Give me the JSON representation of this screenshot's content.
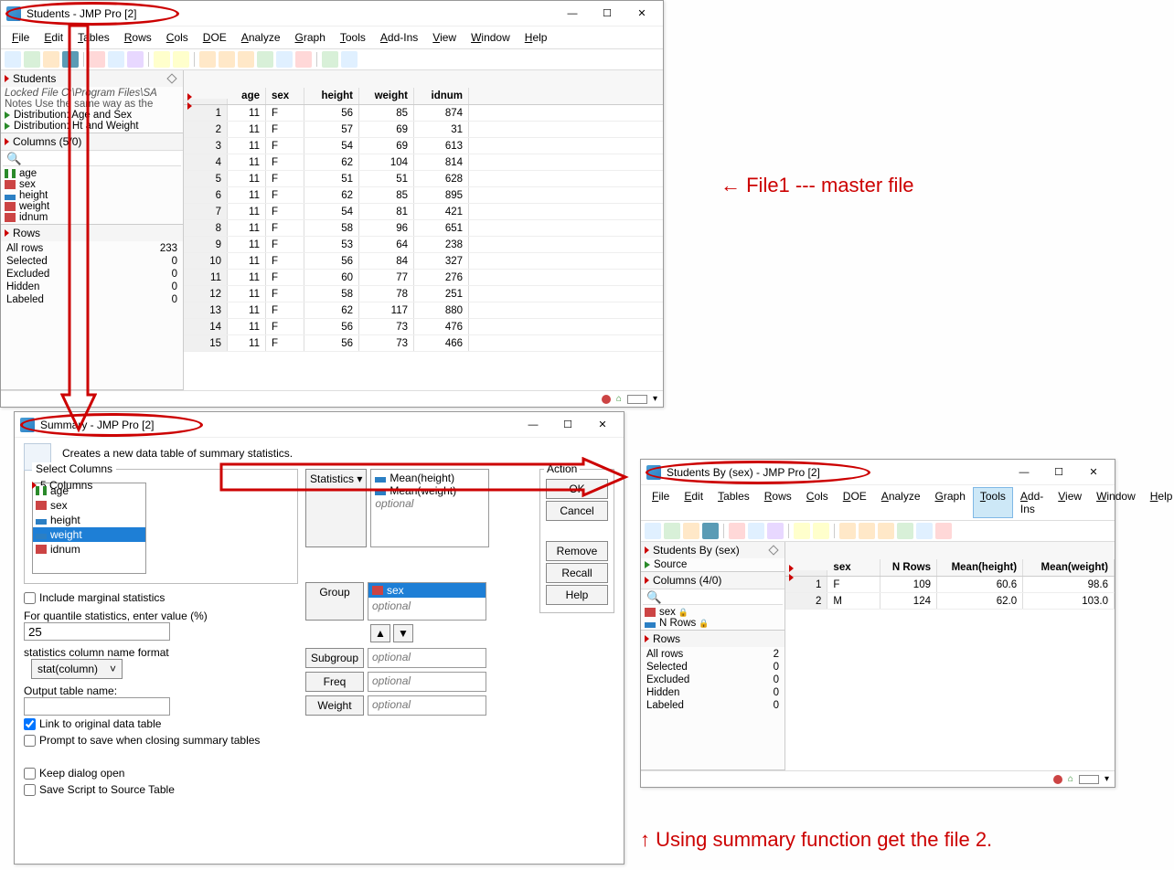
{
  "win1": {
    "title": "Students - JMP Pro [2]",
    "menu": [
      "File",
      "Edit",
      "Tables",
      "Rows",
      "Cols",
      "DOE",
      "Analyze",
      "Graph",
      "Tools",
      "Add-Ins",
      "View",
      "Window",
      "Help"
    ],
    "side_table": "Students",
    "locked": "Locked File  C:\\Program Files\\SA",
    "notes": "Notes  Use the same way as the",
    "scripts": [
      "Distribution: Age and Sex",
      "Distribution: Ht and Weight"
    ],
    "cols_hdr": "Columns (5/0)",
    "columns": [
      {
        "name": "age",
        "t": "ord"
      },
      {
        "name": "sex",
        "t": "nom"
      },
      {
        "name": "height",
        "t": "cont"
      },
      {
        "name": "weight",
        "t": "nom"
      },
      {
        "name": "idnum",
        "t": "nom"
      }
    ],
    "rows_hdr": "Rows",
    "rowstats": [
      [
        "All rows",
        "233"
      ],
      [
        "Selected",
        "0"
      ],
      [
        "Excluded",
        "0"
      ],
      [
        "Hidden",
        "0"
      ],
      [
        "Labeled",
        "0"
      ]
    ],
    "headers": [
      "",
      "age",
      "sex",
      "height",
      "weight",
      "idnum"
    ],
    "data": [
      [
        1,
        11,
        "F",
        56,
        85,
        874
      ],
      [
        2,
        11,
        "F",
        57,
        69,
        31
      ],
      [
        3,
        11,
        "F",
        54,
        69,
        613
      ],
      [
        4,
        11,
        "F",
        62,
        104,
        814
      ],
      [
        5,
        11,
        "F",
        51,
        51,
        628
      ],
      [
        6,
        11,
        "F",
        62,
        85,
        895
      ],
      [
        7,
        11,
        "F",
        54,
        81,
        421
      ],
      [
        8,
        11,
        "F",
        58,
        96,
        651
      ],
      [
        9,
        11,
        "F",
        53,
        64,
        238
      ],
      [
        10,
        11,
        "F",
        56,
        84,
        327
      ],
      [
        11,
        11,
        "F",
        60,
        77,
        276
      ],
      [
        12,
        11,
        "F",
        58,
        78,
        251
      ],
      [
        13,
        11,
        "F",
        62,
        117,
        880
      ],
      [
        14,
        11,
        "F",
        56,
        73,
        476
      ],
      [
        15,
        11,
        "F",
        56,
        73,
        466
      ]
    ]
  },
  "win2": {
    "title": "Summary - JMP Pro [2]",
    "desc": "Creates a new data table of summary statistics.",
    "sel_hdr": "Select Columns",
    "five": "5 Columns",
    "cols": [
      {
        "n": "age",
        "t": "ord"
      },
      {
        "n": "sex",
        "t": "nom"
      },
      {
        "n": "height",
        "t": "cont"
      },
      {
        "n": "weight",
        "t": "cont",
        "sel": true
      },
      {
        "n": "idnum",
        "t": "nom"
      }
    ],
    "incl": "Include marginal statistics",
    "quant_lbl": "For quantile statistics, enter value (%)",
    "quant_val": "25",
    "fmt_lbl": "statistics column name format",
    "fmt_val": "stat(column)",
    "out_lbl": "Output table name:",
    "link": "Link to original data table",
    "prompt": "Prompt to save when closing summary tables",
    "keep": "Keep dialog open",
    "save": "Save Script to Source Table",
    "btn_stats": "Statistics",
    "stat_items": [
      "Mean(height)",
      "Mean(weight)"
    ],
    "btn_group": "Group",
    "group_item": "sex",
    "btn_sub": "Subgroup",
    "btn_freq": "Freq",
    "btn_wt": "Weight",
    "optional": "optional",
    "actions": [
      "OK",
      "Cancel",
      "Remove",
      "Recall",
      "Help"
    ],
    "action_hdr": "Action"
  },
  "win3": {
    "title": "Students By (sex) - JMP Pro [2]",
    "menu": [
      "File",
      "Edit",
      "Tables",
      "Rows",
      "Cols",
      "DOE",
      "Analyze",
      "Graph",
      "Tools",
      "Add-Ins",
      "View",
      "Window",
      "Help"
    ],
    "side_table": "Students By (sex)",
    "source": "Source",
    "cols_hdr": "Columns (4/0)",
    "cols": [
      {
        "n": "sex",
        "t": "nom",
        "lock": true
      },
      {
        "n": "N Rows",
        "t": "cont",
        "lock": true
      }
    ],
    "rows_hdr": "Rows",
    "rowstats": [
      [
        "All rows",
        "2"
      ],
      [
        "Selected",
        "0"
      ],
      [
        "Excluded",
        "0"
      ],
      [
        "Hidden",
        "0"
      ],
      [
        "Labeled",
        "0"
      ]
    ],
    "headers": [
      "",
      "sex",
      "N Rows",
      "Mean(height)",
      "Mean(weight)"
    ],
    "data": [
      [
        1,
        "F",
        109,
        "60.6",
        "98.6"
      ],
      [
        2,
        "M",
        124,
        "62.0",
        "103.0"
      ]
    ]
  },
  "anno": {
    "a1": "←  File1 --- master file",
    "a2": "↑  Using summary function get the file 2."
  }
}
